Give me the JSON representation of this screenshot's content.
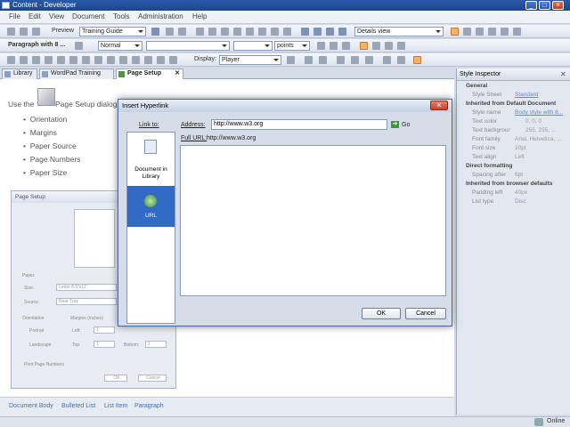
{
  "window": {
    "title": "Content - Developer"
  },
  "menu": [
    "File",
    "Edit",
    "View",
    "Document",
    "Tools",
    "Administration",
    "Help"
  ],
  "toolbar1": {
    "preview_label": "Preview",
    "template_value": "Training Guide",
    "view_value": "Details view"
  },
  "toolbar2": {
    "paragraph_label": "Paragraph with 8 ...",
    "style_value": "Normal",
    "unit_value": "points"
  },
  "toolbar3": {
    "display_label": "Display:",
    "display_value": "Player"
  },
  "tabs": [
    {
      "label": "Library"
    },
    {
      "label": "WordPad Training"
    },
    {
      "label": "Page Setup"
    }
  ],
  "document": {
    "intro": "Use the",
    "intro_tail": "Page Setup dialog",
    "bullets": [
      "Orientation",
      "Margins",
      "Paper Source",
      "Page Numbers",
      "Paper Size"
    ]
  },
  "page_setup_image": {
    "title": "Page Setup",
    "paper": "Paper",
    "size_label": "Size:",
    "size_value": "Letter 8.5\"x11\"",
    "source_label": "Source:",
    "source_value": "Rear Tray",
    "orientation": "Orientation",
    "portrait": "Portrait",
    "landscape": "Landscape",
    "margins": "Margins (inches)",
    "left": "Left:",
    "right": "Right:",
    "top": "Top:",
    "bottom": "Bottom:",
    "margin_value": "1",
    "print_page_numbers": "Print Page Numbers",
    "ok": "OK",
    "cancel": "Cancel"
  },
  "bottom_styles": [
    "Document Body",
    "Bulleted List",
    "List Item",
    "Paragraph"
  ],
  "status": {
    "online": "Online"
  },
  "inspector": {
    "title": "Style Inspector",
    "general": "General",
    "style_sheet_label": "Style Sheet",
    "style_sheet_value": "Standard",
    "inherited_default": "Inherited from Default Document",
    "rows": [
      {
        "k": "Style name",
        "v": "Body style with 8..."
      },
      {
        "k": "Text color",
        "v": "0, 0, 0"
      },
      {
        "k": "Text backgrour",
        "v": "255, 255, ..."
      },
      {
        "k": "Font family",
        "v": "Arial, Helvetica, ..."
      },
      {
        "k": "Font size",
        "v": "10pt"
      },
      {
        "k": "Text align",
        "v": "Left"
      }
    ],
    "direct_formatting": "Direct formatting",
    "spacing_label": "Spacing after",
    "spacing_value": "6pt",
    "inherited_browser": "Inherited from browser defaults",
    "padding_label": "Padding left",
    "padding_value": "40px",
    "list_type_label": "List type",
    "list_type_value": "Disc"
  },
  "dialog": {
    "title": "Insert Hyperlink",
    "link_to": "Link to:",
    "options": [
      {
        "label": "Document in Library"
      },
      {
        "label": "URL"
      }
    ],
    "address_label": "Address:",
    "address_value": "http://www.w3.org",
    "go_label": "Go",
    "full_url_label": "Full URL:",
    "full_url_value": "http://www.w3.org",
    "ok": "OK",
    "cancel": "Cancel"
  },
  "colors": {
    "accent": "#316ac5",
    "titlebar": "#2a5aa8",
    "highlight": "#f6b26b"
  }
}
